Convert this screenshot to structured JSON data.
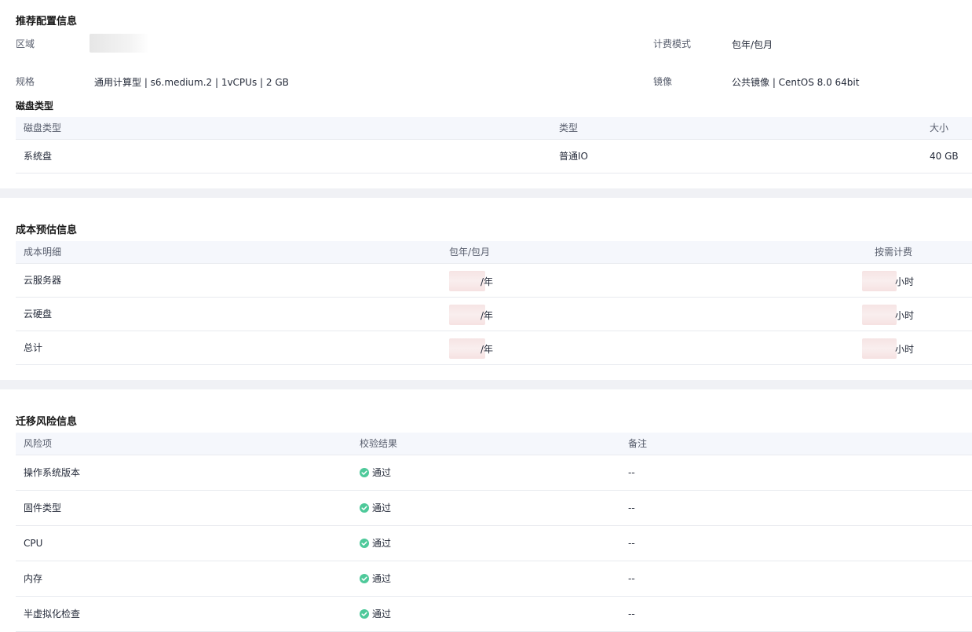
{
  "config": {
    "title": "推荐配置信息",
    "region_label": "区域",
    "billing_label": "计费模式",
    "billing_value": "包年/包月",
    "spec_label": "规格",
    "spec_value": "通用计算型 | s6.medium.2 | 1vCPUs | 2 GB",
    "image_label": "镜像",
    "image_value": "公共镜像 | CentOS 8.0 64bit",
    "disk_subtitle": "磁盘类型",
    "disk_table": {
      "headers": [
        "磁盘类型",
        "类型",
        "大小"
      ],
      "rows": [
        [
          "系统盘",
          "普通IO",
          "40 GB"
        ]
      ]
    }
  },
  "cost": {
    "title": "成本预估信息",
    "headers": [
      "成本明细",
      "包年/包月",
      "按需计费"
    ],
    "rows": [
      {
        "item": "云服务器",
        "yearly_suffix": "/年",
        "ondemand_suffix": "小时"
      },
      {
        "item": "云硬盘",
        "yearly_suffix": "/年",
        "ondemand_suffix": "小时"
      },
      {
        "item": "总计",
        "yearly_suffix": "/年",
        "ondemand_suffix": "小时"
      }
    ]
  },
  "risk": {
    "title": "迁移风险信息",
    "headers": [
      "风险项",
      "校验结果",
      "备注"
    ],
    "rows": [
      {
        "item": "操作系统版本",
        "result": "通过",
        "note": "--"
      },
      {
        "item": "固件类型",
        "result": "通过",
        "note": "--"
      },
      {
        "item": "CPU",
        "result": "通过",
        "note": "--"
      },
      {
        "item": "内存",
        "result": "通过",
        "note": "--"
      },
      {
        "item": "半虚拟化检查",
        "result": "通过",
        "note": "--"
      }
    ]
  },
  "colors": {
    "pass": "#4ec99a",
    "header_bg": "#f5f7fc",
    "separator": "#f0f1f5"
  }
}
